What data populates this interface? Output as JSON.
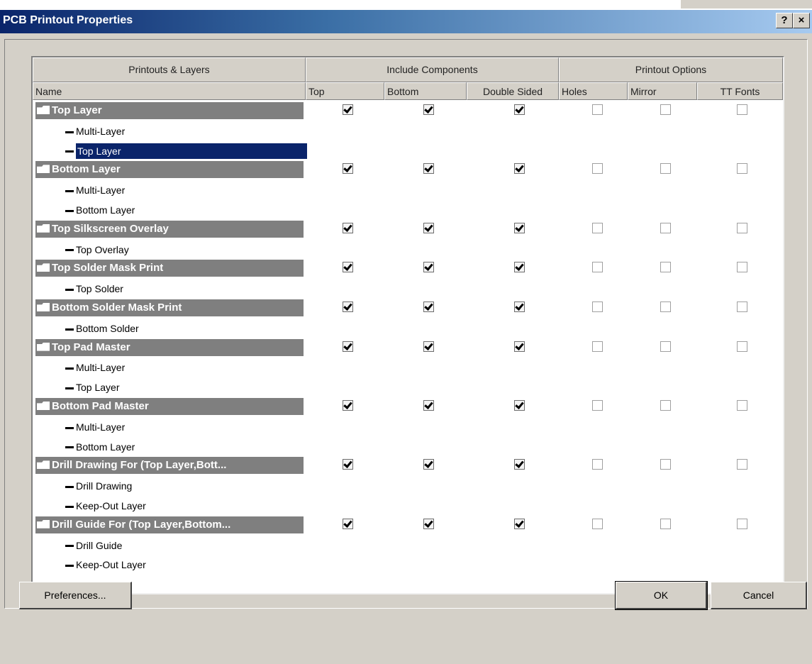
{
  "window": {
    "title": "PCB Printout Properties",
    "help_label": "?",
    "close_label": "×"
  },
  "header_groups": {
    "printouts_layers": "Printouts & Layers",
    "include_components": "Include Components",
    "printout_options": "Printout Options"
  },
  "columns": {
    "name": "Name",
    "top": "Top",
    "bottom": "Bottom",
    "double_sided": "Double Sided",
    "holes": "Holes",
    "mirror": "Mirror",
    "tt_fonts": "TT Fonts"
  },
  "rows": [
    {
      "type": "group",
      "label": "Top Layer",
      "top": true,
      "bottom": true,
      "double_sided": true,
      "holes": false,
      "mirror": false,
      "tt_fonts": false
    },
    {
      "type": "child",
      "label": "Multi-Layer"
    },
    {
      "type": "child",
      "label": "Top Layer",
      "selected": true
    },
    {
      "type": "group",
      "label": "Bottom Layer",
      "top": true,
      "bottom": true,
      "double_sided": true,
      "holes": false,
      "mirror": false,
      "tt_fonts": false
    },
    {
      "type": "child",
      "label": "Multi-Layer"
    },
    {
      "type": "child",
      "label": "Bottom Layer"
    },
    {
      "type": "group",
      "label": "Top Silkscreen Overlay",
      "top": true,
      "bottom": true,
      "double_sided": true,
      "holes": false,
      "mirror": false,
      "tt_fonts": false
    },
    {
      "type": "child",
      "label": "Top Overlay"
    },
    {
      "type": "group",
      "label": "Top Solder Mask Print",
      "top": true,
      "bottom": true,
      "double_sided": true,
      "holes": false,
      "mirror": false,
      "tt_fonts": false
    },
    {
      "type": "child",
      "label": "Top Solder"
    },
    {
      "type": "group",
      "label": "Bottom Solder Mask Print",
      "top": true,
      "bottom": true,
      "double_sided": true,
      "holes": false,
      "mirror": false,
      "tt_fonts": false
    },
    {
      "type": "child",
      "label": "Bottom Solder"
    },
    {
      "type": "group",
      "label": "Top Pad Master",
      "top": true,
      "bottom": true,
      "double_sided": true,
      "holes": false,
      "mirror": false,
      "tt_fonts": false
    },
    {
      "type": "child",
      "label": "Multi-Layer"
    },
    {
      "type": "child",
      "label": "Top Layer"
    },
    {
      "type": "group",
      "label": "Bottom Pad Master",
      "top": true,
      "bottom": true,
      "double_sided": true,
      "holes": false,
      "mirror": false,
      "tt_fonts": false
    },
    {
      "type": "child",
      "label": "Multi-Layer"
    },
    {
      "type": "child",
      "label": "Bottom Layer"
    },
    {
      "type": "group",
      "label": "Drill Drawing For (Top Layer,Bott...",
      "top": true,
      "bottom": true,
      "double_sided": true,
      "holes": false,
      "mirror": false,
      "tt_fonts": false
    },
    {
      "type": "child",
      "label": "Drill Drawing"
    },
    {
      "type": "child",
      "label": "Keep-Out Layer"
    },
    {
      "type": "group",
      "label": "Drill Guide For (Top Layer,Bottom...",
      "top": true,
      "bottom": true,
      "double_sided": true,
      "holes": false,
      "mirror": false,
      "tt_fonts": false
    },
    {
      "type": "child",
      "label": "Drill Guide"
    },
    {
      "type": "child",
      "label": "Keep-Out Layer"
    }
  ],
  "buttons": {
    "preferences": "Preferences...",
    "ok": "OK",
    "cancel": "Cancel"
  }
}
